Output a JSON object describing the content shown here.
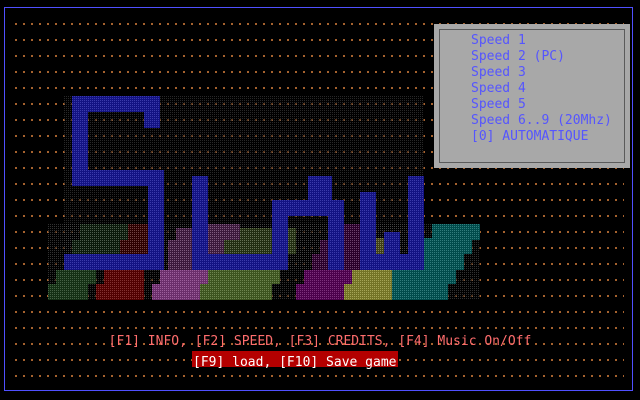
{
  "colors": {
    "background": "#000000",
    "frame": "#5050ff",
    "dots": "#d07a3a",
    "panel": "#a8a8a8",
    "panel_text": "#5555ff",
    "menu_text": "#ff6d6d",
    "highlight_bg": "#b40000",
    "highlight_text": "#ffffff",
    "logo_blue": "#2222ee"
  },
  "speed_menu": {
    "items": [
      {
        "label": "Speed 1"
      },
      {
        "label": "Speed 2 (PC)"
      },
      {
        "label": "Speed 3"
      },
      {
        "label": "Speed 4"
      },
      {
        "label": "Speed 5"
      },
      {
        "label": "Speed 6..9 (20Mhz)"
      },
      {
        "label": "[0] AUTOMATIQUE"
      }
    ]
  },
  "logo": {
    "icon": "game-title-logo"
  },
  "footer": {
    "line1": "[F1] INFO, [F2] SPEED, [F3] CREDITS, [F4] Music On/Off",
    "line2": "[F9] load, [F10] Save game"
  }
}
